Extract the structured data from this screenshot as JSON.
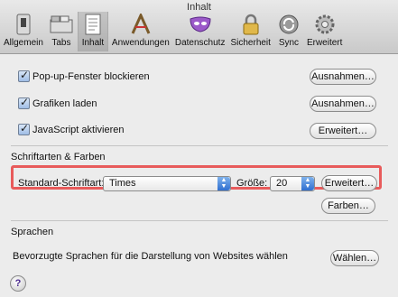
{
  "window": {
    "title": "Inhalt"
  },
  "toolbar": [
    {
      "label": "Allgemein",
      "icon": "switch-icon",
      "selected": false
    },
    {
      "label": "Tabs",
      "icon": "tabs-icon",
      "selected": false
    },
    {
      "label": "Inhalt",
      "icon": "document-icon",
      "selected": true
    },
    {
      "label": "Anwendungen",
      "icon": "applications-icon",
      "selected": false
    },
    {
      "label": "Datenschutz",
      "icon": "mask-icon",
      "selected": false
    },
    {
      "label": "Sicherheit",
      "icon": "lock-icon",
      "selected": false
    },
    {
      "label": "Sync",
      "icon": "sync-icon",
      "selected": false
    },
    {
      "label": "Erweitert",
      "icon": "gear-icon",
      "selected": false
    }
  ],
  "options": {
    "popup": {
      "label": "Pop-up-Fenster blockieren",
      "checked": true,
      "button": "Ausnahmen…"
    },
    "images": {
      "label": "Grafiken laden",
      "checked": true,
      "button": "Ausnahmen…"
    },
    "javascript": {
      "label": "JavaScript aktivieren",
      "checked": true,
      "button": "Erweitert…"
    }
  },
  "fonts": {
    "section_title": "Schriftarten & Farben",
    "default_font_label": "Standard-Schriftart:",
    "default_font_value": "Times",
    "size_label": "Größe:",
    "size_value": "20",
    "advanced_button": "Erweitert…",
    "colors_button": "Farben…"
  },
  "languages": {
    "section_title": "Sprachen",
    "description": "Bevorzugte Sprachen für die Darstellung von Websites wählen",
    "choose_button": "Wählen…"
  },
  "help": {
    "symbol": "?"
  },
  "colors": {
    "highlight": "#e85b5b",
    "checkbox": "#9fbde6",
    "select_arrows": "#2f6fd0"
  }
}
